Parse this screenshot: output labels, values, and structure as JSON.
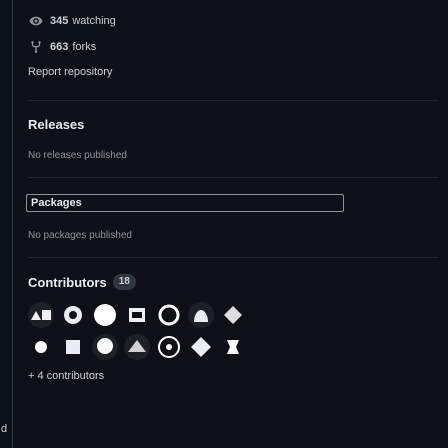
{
  "stats": {
    "watching": {
      "count": "345",
      "label": "watching"
    },
    "forks": {
      "count": "663",
      "label": "forks"
    }
  },
  "report_label": "Report repository",
  "releases": {
    "title": "Releases",
    "empty": "No releases published"
  },
  "packages": {
    "title": "Packages",
    "empty": "No packages published"
  },
  "contributors": {
    "title": "Contributors",
    "count": "18",
    "more_label": "+ 4 contributors",
    "avatars": [
      {
        "bg": "#1c2128",
        "fg": "#ffffff"
      },
      {
        "bg": "#0d1117",
        "fg": "#e6edf3"
      },
      {
        "bg": "#0d1117",
        "fg": "#ffffff"
      },
      {
        "bg": "#0d1117",
        "fg": "#f0f0f0"
      },
      {
        "bg": "#0d1117",
        "fg": "#ffffff"
      },
      {
        "bg": "#1c2128",
        "fg": "#e6edf3"
      },
      {
        "bg": "#0d1117",
        "fg": "#dddddd"
      },
      {
        "bg": "#0d1117",
        "fg": "#ffffff"
      },
      {
        "bg": "#0d1117",
        "fg": "#e6edf3"
      },
      {
        "bg": "#1c2128",
        "fg": "#ffffff"
      },
      {
        "bg": "#1c2128",
        "fg": "#d0d0d0"
      },
      {
        "bg": "#0d1117",
        "fg": "#ffffff"
      },
      {
        "bg": "#0d1117",
        "fg": "#e6edf3"
      },
      {
        "bg": "#0d1117",
        "fg": "#ffffff"
      }
    ]
  },
  "left_edge_char": "d",
  "colors": {
    "background": "#0d1117",
    "text": "#c9d1d9",
    "muted": "#8b949e",
    "border": "#30363d"
  }
}
